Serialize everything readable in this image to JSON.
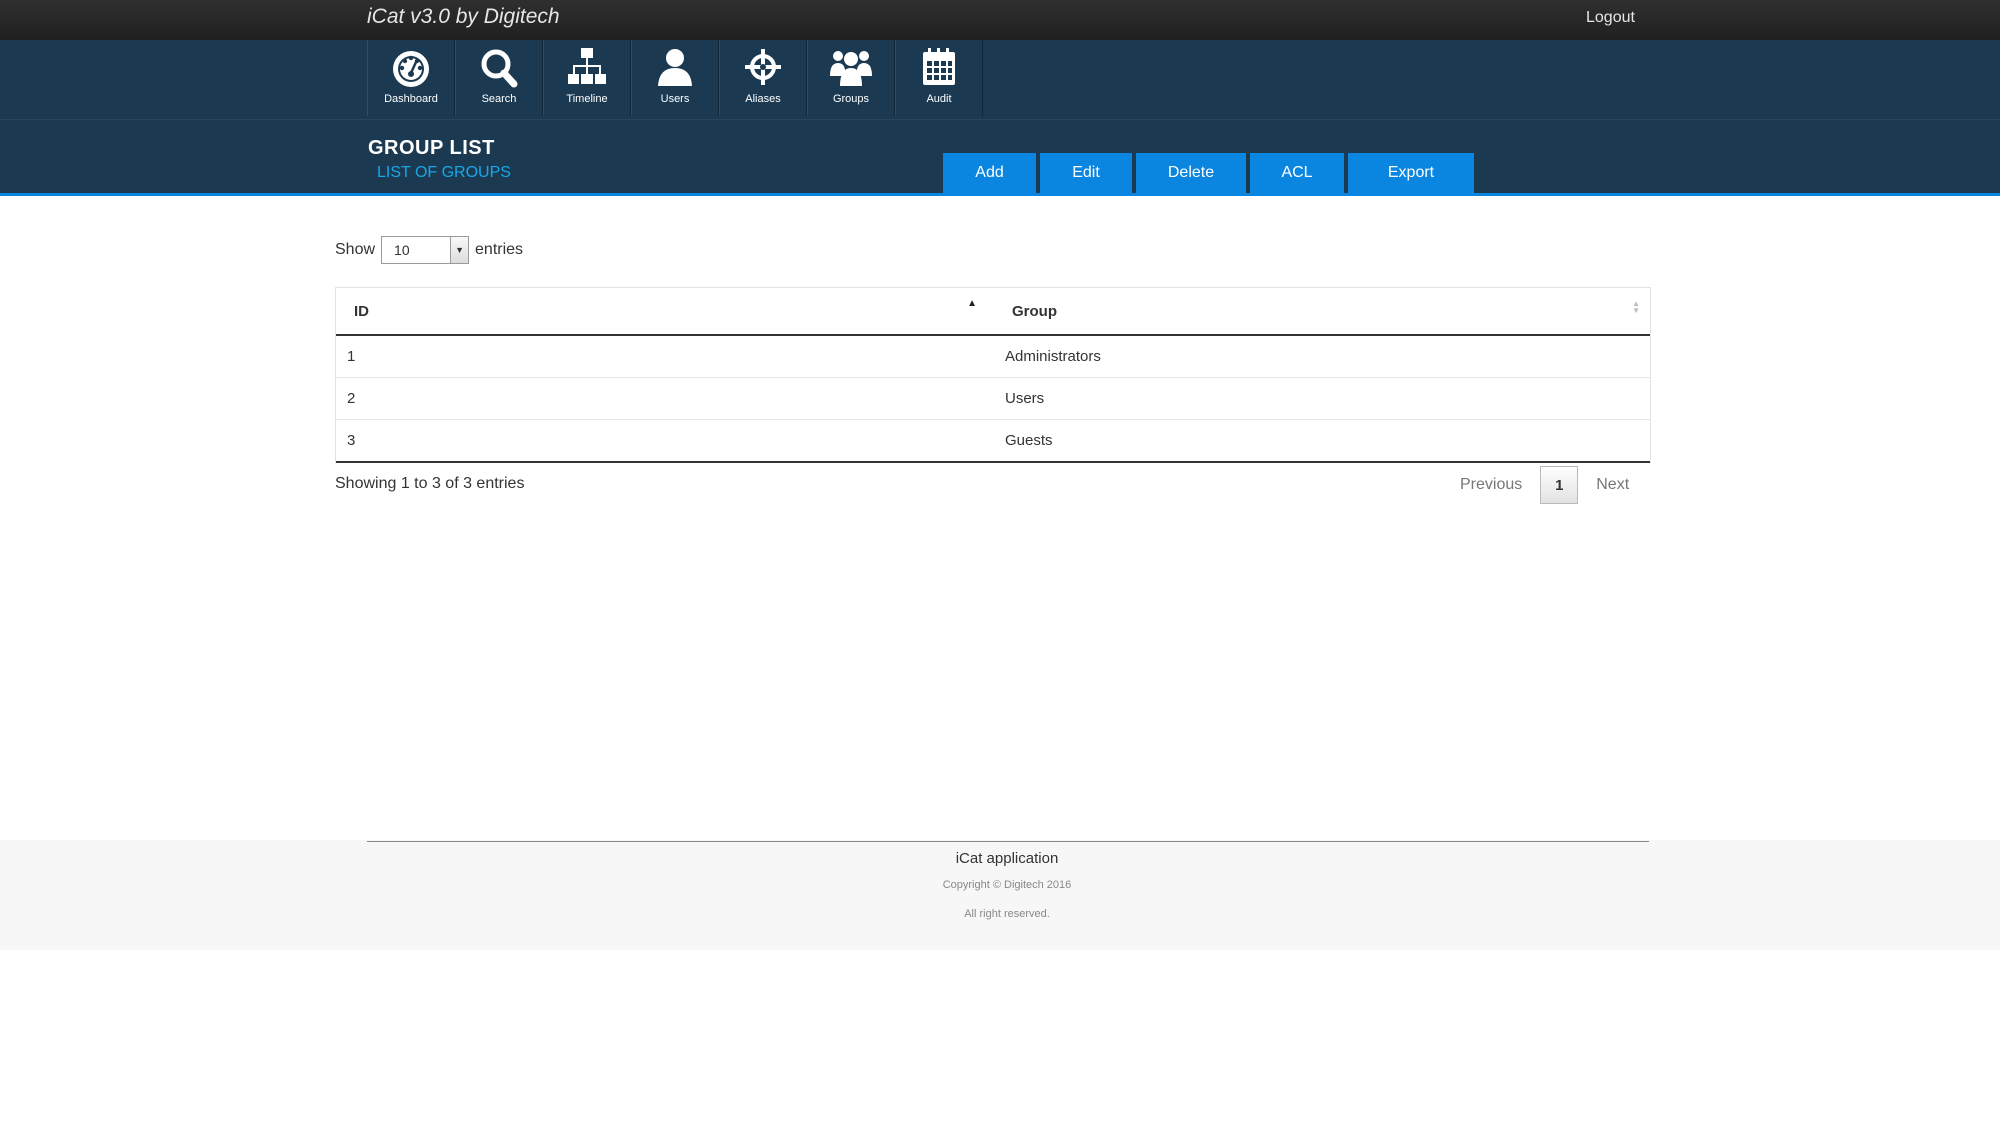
{
  "app": {
    "title": "iCat v3.0 by Digitech",
    "logout_label": "Logout"
  },
  "nav": [
    {
      "label": "Dashboard",
      "icon": "dashboard-icon"
    },
    {
      "label": "Search",
      "icon": "search-icon"
    },
    {
      "label": "Timeline",
      "icon": "timeline-icon"
    },
    {
      "label": "Users",
      "icon": "user-icon"
    },
    {
      "label": "Aliases",
      "icon": "crosshair-icon"
    },
    {
      "label": "Groups",
      "icon": "groups-icon"
    },
    {
      "label": "Audit",
      "icon": "calendar-icon"
    }
  ],
  "page": {
    "title": "GROUP LIST",
    "subtitle": "LIST OF GROUPS"
  },
  "actions": {
    "add": "Add",
    "edit": "Edit",
    "delete": "Delete",
    "acl": "ACL",
    "export": "Export"
  },
  "length_menu": {
    "prefix": "Show",
    "value": "10",
    "suffix": "entries"
  },
  "table": {
    "columns": {
      "id": "ID",
      "group": "Group"
    },
    "rows": [
      {
        "id": "1",
        "group": "Administrators"
      },
      {
        "id": "2",
        "group": "Users"
      },
      {
        "id": "3",
        "group": "Guests"
      }
    ]
  },
  "info": "Showing 1 to 3 of 3 entries",
  "pagination": {
    "previous": "Previous",
    "current": "1",
    "next": "Next"
  },
  "footer": {
    "app_name": "iCat application",
    "copyright": "Copyright © Digitech 2016",
    "rights": "All right reserved."
  },
  "colors": {
    "nav_bg": "#1b3a52",
    "accent": "#0b86e0",
    "subtitle": "#18a7e8"
  }
}
